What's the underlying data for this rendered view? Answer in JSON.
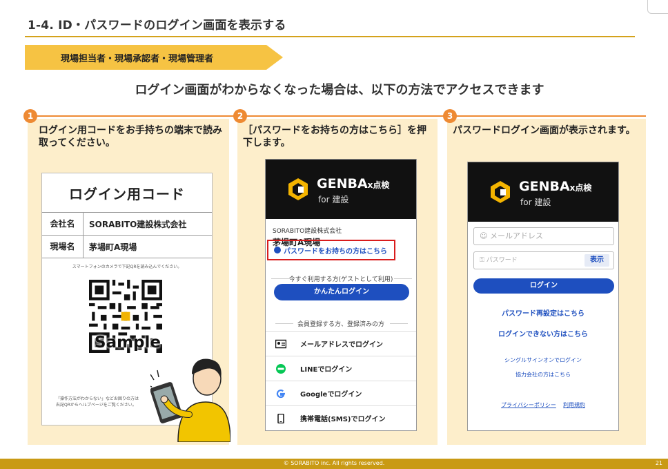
{
  "header": {
    "title": "1-4. ID・パスワードのログイン画面を表示する",
    "role_banner": "現場担当者・現場承認者・現場管理者",
    "headline": "ログイン画面がわからなくなった場合は、以下の方法でアクセスできます"
  },
  "steps": [
    {
      "number": "1",
      "text": "ログイン用コードをお手持ちの端末で読み取ってください。"
    },
    {
      "number": "2",
      "text": "［パスワードをお持ちの方はこちら］を押下します。"
    },
    {
      "number": "3",
      "text": "パスワードログイン画面が表示されます。"
    }
  ],
  "login_code_card": {
    "title": "ログイン用コード",
    "company_label": "会社名",
    "company_value": "SORABITO建設株式会社",
    "site_label": "現場名",
    "site_value": "茅場町A現場",
    "note": "スマートフォンのカメラで下記QRを読み込んでください。",
    "sample": "Sample",
    "footer_note_1": "「操作方法がわからない」などお困りの方は",
    "footer_note_2": "右記QRからヘルプページをご覧ください。"
  },
  "app": {
    "name": "GENBA",
    "name_suffix": "x点検",
    "sub": "for 建設"
  },
  "screen2": {
    "company": "SORABITO建設株式会社",
    "site": "茅場町A現場",
    "password_link": "パスワードをお持ちの方はこちら",
    "guest_divider": "今すぐ利用する方(ゲストとして利用)",
    "easy_login": "かんたんログイン",
    "member_divider": "会員登録する方、登録済みの方",
    "methods": [
      {
        "icon": "id-card-icon",
        "label": "メールアドレスでログイン"
      },
      {
        "icon": "line-icon",
        "label": "LINEでログイン"
      },
      {
        "icon": "google-icon",
        "label": "Googleでログイン"
      },
      {
        "icon": "phone-icon",
        "label": "携帯電話(SMS)でログイン"
      }
    ]
  },
  "screen3": {
    "email_placeholder": "メールアドレス",
    "password_placeholder": "パスワード",
    "show_label": "表示",
    "login_button": "ログイン",
    "reset_link": "パスワード再設定はこちら",
    "cant_login_link": "ログインできない方はこちら",
    "sso_link": "シングルサインオンでログイン",
    "partner_link": "協力会社の方はこちら",
    "privacy_link": "プライバシーポリシー",
    "terms_link": "利用規約"
  },
  "footer": {
    "copyright": "© SORABITO inc. All rights reserved.",
    "page_number": "21"
  },
  "colors": {
    "accent_yellow": "#f6c343",
    "step_orange": "#ee8a33",
    "panel_bg": "#fdeecb",
    "link_blue": "#1e4fbf",
    "highlight_red": "#d91c1c",
    "footer_gold": "#c99a14"
  }
}
